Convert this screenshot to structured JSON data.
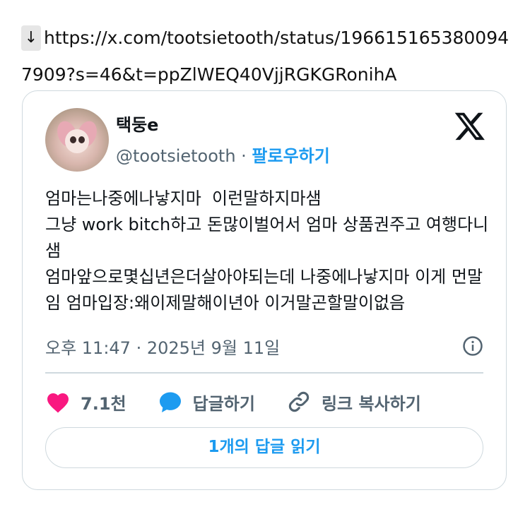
{
  "link": {
    "arrow": "↓",
    "url": "https://x.com/tootsietooth/status/1966151653800947909?s=46&t=ppZlWEQ40VjjRGKGRonihA"
  },
  "tweet": {
    "display_name": "택둥e",
    "handle": "@tootsietooth",
    "separator": " · ",
    "follow_label": "팔로우하기",
    "text": "엄마는나중에나낳지마  이런말하지마샘\n그냥 work bitch하고 돈많이벌어서 엄마 상품권주고 여행다니샘\n엄마앞으로몇십년은더살아야되는데 나중에나낳지마 이게 먼말임 엄마입장:왜이제말해이년아 이거말곤할말이없음",
    "timestamp": "오후 11:47 · 2025년 9월 11일",
    "likes_label": "7.1천",
    "reply_label": "답글하기",
    "copy_link_label": "링크 복사하기",
    "read_replies_label": "1개의 답글 읽기"
  },
  "colors": {
    "accent": "#1d9bf0",
    "like": "#f91880",
    "muted": "#536471",
    "border": "#cfd9de"
  },
  "icons": [
    "x-logo-icon",
    "info-icon",
    "heart-icon",
    "reply-bubble-icon",
    "link-icon"
  ]
}
